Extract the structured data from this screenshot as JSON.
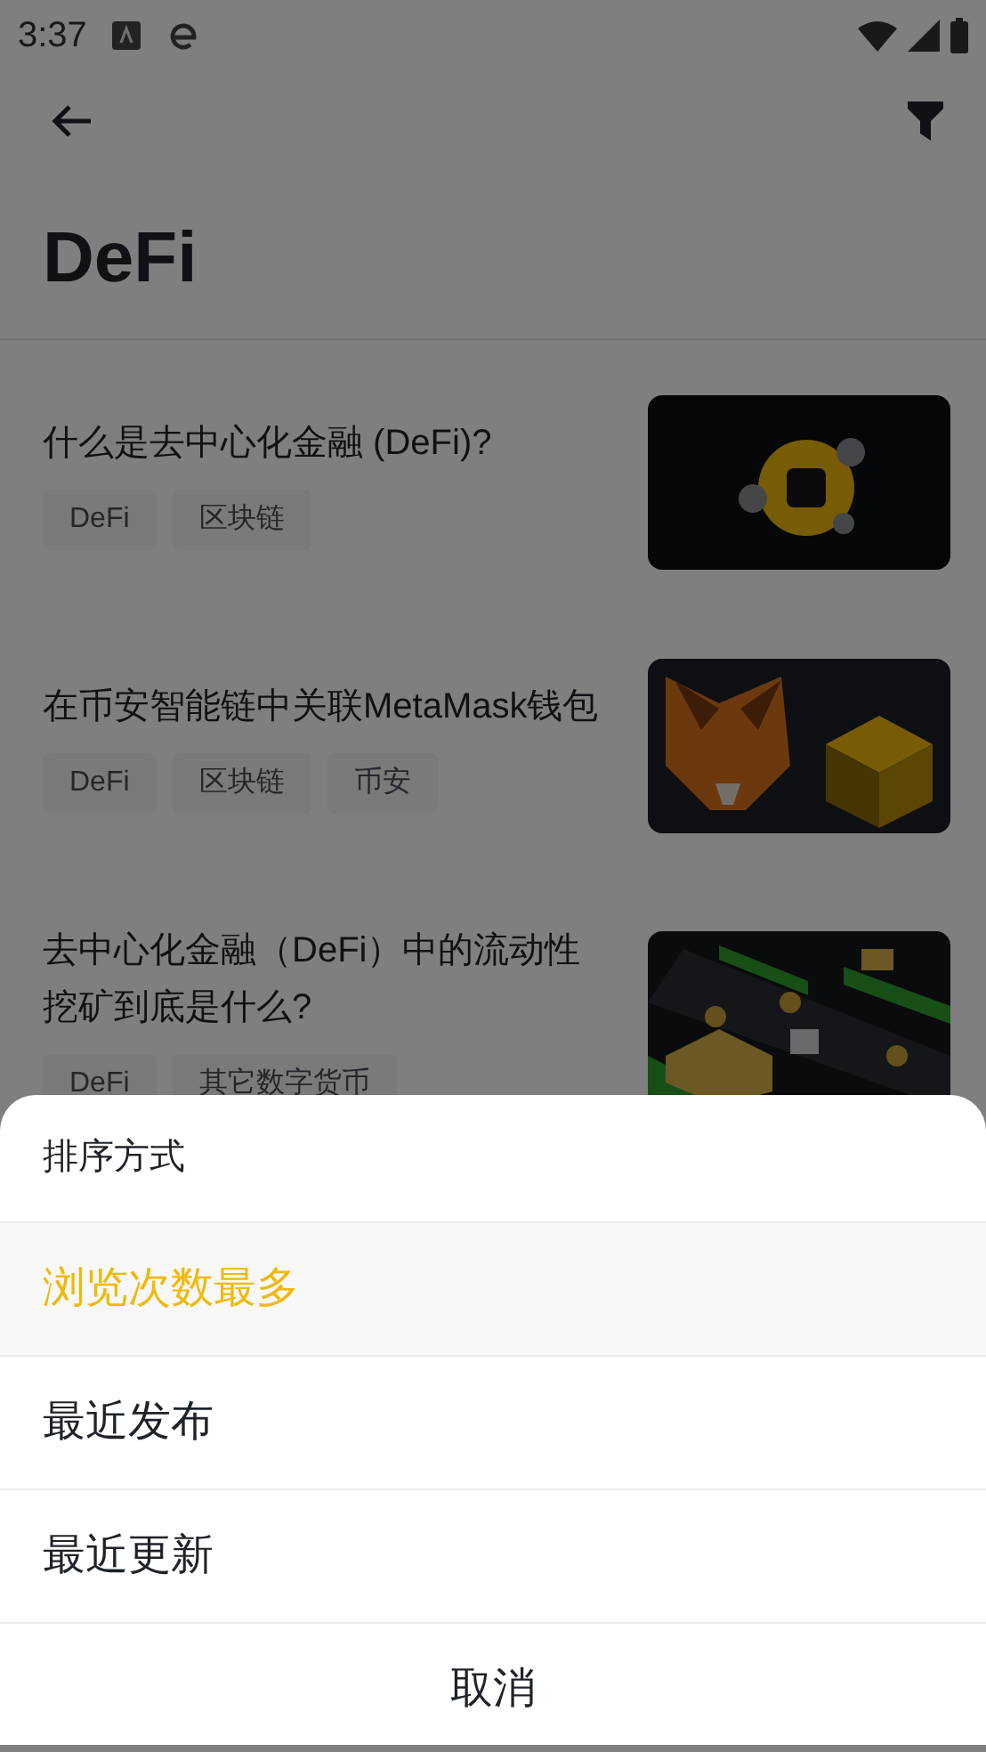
{
  "status_bar": {
    "time": "3:37"
  },
  "header": {
    "title": "DeFi"
  },
  "articles": [
    {
      "title": "什么是去中心化金融 (DeFi)?",
      "tags": [
        "DeFi",
        "区块链"
      ],
      "image": {
        "kind": "picture"
      }
    },
    {
      "title": "在币安智能链中关联MetaMask钱包",
      "tags": [
        "DeFi",
        "区块链",
        "币安"
      ],
      "image": {
        "kind": "picture"
      }
    },
    {
      "title": "去中心化金融（DeFi）中的流动性挖矿到底是什么?",
      "tags": [
        "DeFi",
        "其它数字货币"
      ],
      "image": {
        "kind": "picture"
      }
    }
  ],
  "sort_sheet": {
    "title": "排序方式",
    "options": [
      {
        "label": "浏览次数最多",
        "selected": true
      },
      {
        "label": "最近发布",
        "selected": false
      },
      {
        "label": "最近更新",
        "selected": false
      }
    ],
    "cancel": "取消"
  }
}
